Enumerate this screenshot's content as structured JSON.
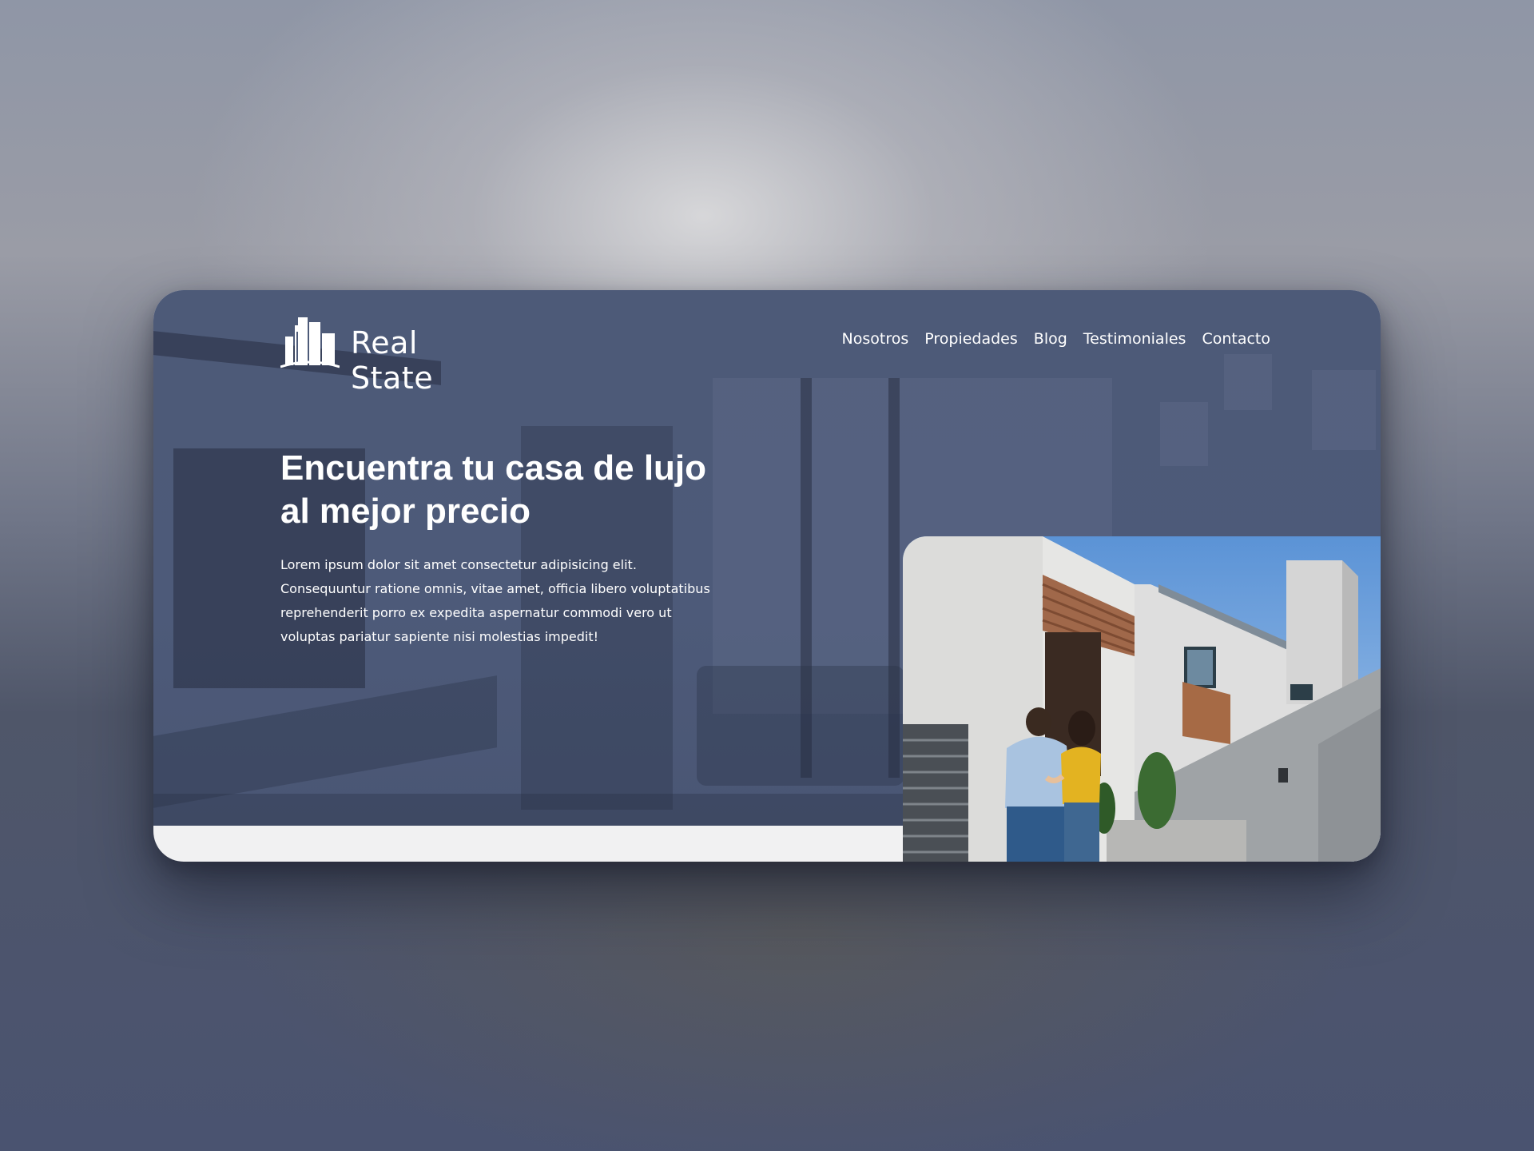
{
  "brand": {
    "name": "Real State",
    "logo_icon": "buildings-icon"
  },
  "nav": {
    "items": [
      {
        "label": "Nosotros"
      },
      {
        "label": "Propiedades"
      },
      {
        "label": "Blog"
      },
      {
        "label": "Testimoniales"
      },
      {
        "label": "Contacto"
      }
    ]
  },
  "hero": {
    "title": "Encuentra tu casa de lujo al mejor precio",
    "description": "Lorem ipsum dolor sit amet consectetur adipisicing elit. Consequuntur ratione omnis, vitae amet, officia libero voluptatibus reprehenderit porro ex expedita aspernatur commodi vero ut voluptas pariatur sapiente nisi molestias impedit!"
  },
  "colors": {
    "hero_overlay": "#4d5a78",
    "text": "#ffffff",
    "footer_strip": "#f1f1f2"
  }
}
